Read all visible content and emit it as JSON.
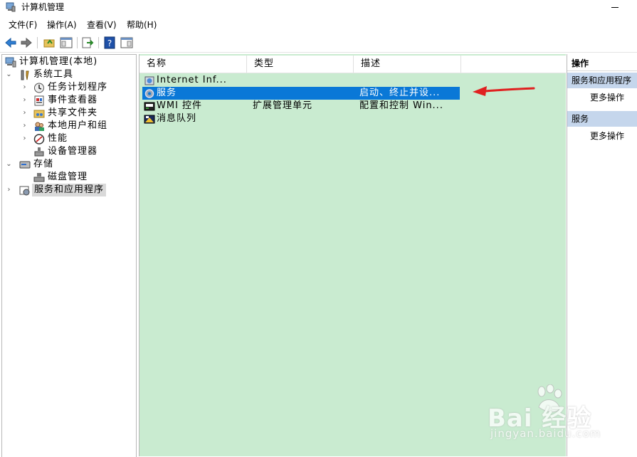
{
  "window": {
    "title": "计算机管理"
  },
  "menu": [
    "文件(F)",
    "操作(A)",
    "查看(V)",
    "帮助(H)"
  ],
  "tree": [
    {
      "label": "计算机管理(本地)",
      "level": 0,
      "expander": "",
      "icon": "computer-management-icon"
    },
    {
      "label": "系统工具",
      "level": 1,
      "expander": "expanded",
      "icon": "system-tools-icon"
    },
    {
      "label": "任务计划程序",
      "level": 2,
      "expander": "collapsed",
      "icon": "task-scheduler-icon"
    },
    {
      "label": "事件查看器",
      "level": 2,
      "expander": "collapsed",
      "icon": "event-viewer-icon"
    },
    {
      "label": "共享文件夹",
      "level": 2,
      "expander": "collapsed",
      "icon": "shared-folders-icon"
    },
    {
      "label": "本地用户和组",
      "level": 2,
      "expander": "collapsed",
      "icon": "local-users-icon"
    },
    {
      "label": "性能",
      "level": 2,
      "expander": "collapsed",
      "icon": "performance-icon"
    },
    {
      "label": "设备管理器",
      "level": 2,
      "expander": "",
      "icon": "device-manager-icon"
    },
    {
      "label": "存储",
      "level": 1,
      "expander": "expanded",
      "icon": "storage-icon"
    },
    {
      "label": "磁盘管理",
      "level": 2,
      "expander": "",
      "icon": "disk-management-icon"
    },
    {
      "label": "服务和应用程序",
      "level": 1,
      "expander": "collapsed",
      "icon": "services-apps-icon",
      "selected": true
    }
  ],
  "list": {
    "columns": [
      "名称",
      "类型",
      "描述"
    ],
    "rows": [
      {
        "name": "Internet Inf...",
        "type": "",
        "desc": "",
        "icon": "iis-icon"
      },
      {
        "name": "服务",
        "type": "",
        "desc": "启动、终止并设...",
        "icon": "services-gear-icon",
        "selected": true
      },
      {
        "name": "WMI 控件",
        "type": "扩展管理单元",
        "desc": "配置和控制 Win...",
        "icon": "wmi-icon"
      },
      {
        "name": "消息队列",
        "type": "",
        "desc": "",
        "icon": "message-queue-icon"
      }
    ]
  },
  "actions": {
    "header": "操作",
    "sections": [
      {
        "title": "服务和应用程序",
        "link": "更多操作"
      },
      {
        "title": "服务",
        "link": "更多操作"
      }
    ]
  },
  "watermark": {
    "brand": "Bai  经验",
    "sub": "jingyan.baidu.com"
  },
  "colors": {
    "list_bg": "#c9ebd0",
    "selected_row": "#0a78d7",
    "action_section": "#c5d6ec",
    "arrow": "#e02020"
  }
}
